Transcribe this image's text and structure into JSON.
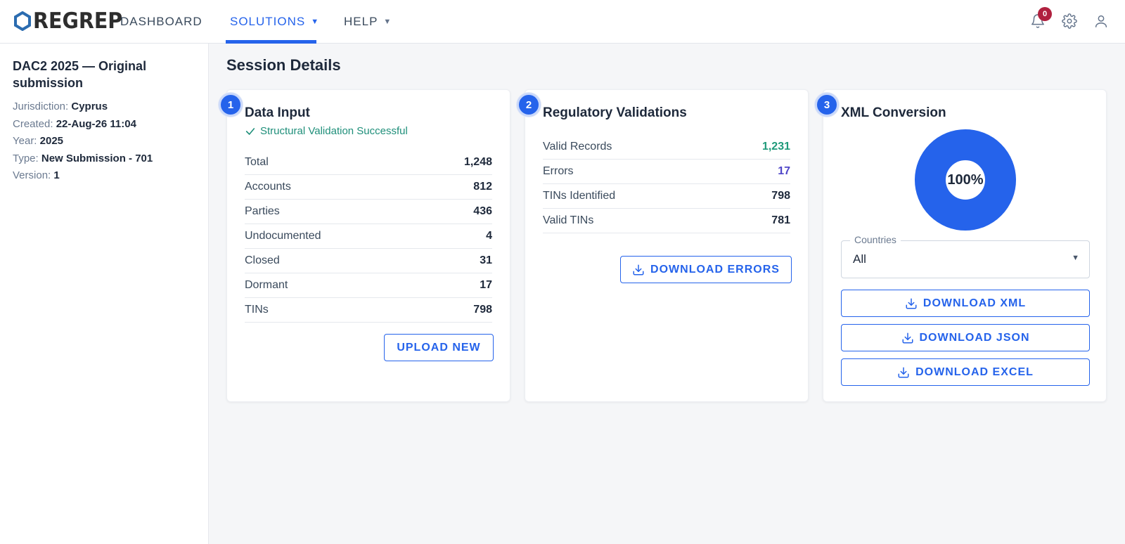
{
  "nav": {
    "brand": "REGREP",
    "items": [
      {
        "label": "DASHBOARD"
      },
      {
        "label": "SOLUTIONS"
      },
      {
        "label": "HELP"
      }
    ],
    "notification_count": "0",
    "icons": [
      "bell-icon",
      "gear-icon",
      "user-icon"
    ],
    "accent_color": "#2563eb"
  },
  "sidebar": {
    "title": "DAC2 2025 — Original submission",
    "fields": [
      {
        "label": "Jurisdiction:",
        "value": "Cyprus"
      },
      {
        "label": "Created:",
        "value": "22-Aug-26 11:04"
      },
      {
        "label": "Year:",
        "value": "2025"
      },
      {
        "label": "Type:",
        "value": "New Submission - 701"
      },
      {
        "label": "Version:",
        "value": "1"
      }
    ]
  },
  "main": {
    "title": "Session Details",
    "data_input": {
      "step": "1",
      "title": "Data Input",
      "status": "Structural Validation Successful",
      "rows": [
        {
          "label": "Total",
          "value": "1,248"
        },
        {
          "label": "Accounts",
          "value": "812"
        },
        {
          "label": "Parties",
          "value": "436"
        },
        {
          "label": "Undocumented",
          "value": "4"
        },
        {
          "label": "Closed",
          "value": "31"
        },
        {
          "label": "Dormant",
          "value": "17"
        },
        {
          "label": "TINs",
          "value": "798"
        }
      ],
      "button": "UPLOAD NEW"
    },
    "validations": {
      "step": "2",
      "title": "Regulatory Validations",
      "rows": [
        {
          "label": "Valid Records",
          "value": "1,231"
        },
        {
          "label": "Errors",
          "value": "17"
        },
        {
          "label": "TINs Identified",
          "value": "798"
        },
        {
          "label": "Valid TINs",
          "value": "781"
        }
      ],
      "button": "DOWNLOAD ERRORS",
      "valid_color": "#1f9a7a",
      "error_color": "#4f46c8"
    },
    "xml": {
      "step": "3",
      "title": "XML Conversion",
      "progress_label": "100%",
      "progress": 1.0,
      "countries": {
        "label": "Countries",
        "value": "All"
      },
      "buttons": [
        "DOWNLOAD XML",
        "DOWNLOAD JSON",
        "DOWNLOAD EXCEL"
      ]
    }
  }
}
